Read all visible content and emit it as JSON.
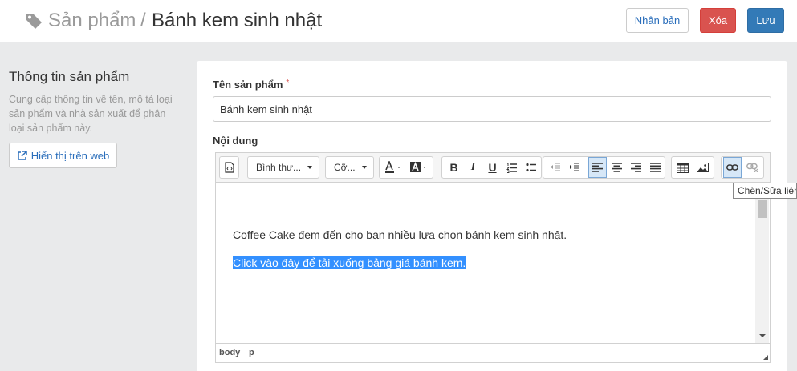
{
  "header": {
    "breadcrumb_root": "Sản phẩm",
    "breadcrumb_sep": "/",
    "title": "Bánh kem sinh nhật",
    "duplicate_label": "Nhân bản",
    "delete_label": "Xóa",
    "save_label": "Lưu"
  },
  "sidebar": {
    "title": "Thông tin sản phẩm",
    "description": "Cung cấp thông tin về tên, mô tả loại sản phẩm và nhà sản xuất để phân loại sản phẩm này.",
    "web_button_label": "Hiển thị trên web"
  },
  "form": {
    "name_label": "Tên sản phẩm",
    "required_mark": "*",
    "name_value": "Bánh kem sinh nhật",
    "content_label": "Nội dung"
  },
  "editor": {
    "format_select": "Bình thư...",
    "size_select": "Cỡ...",
    "paragraph_1": "Coffee Cake đem đến cho bạn nhiều lựa chọn bánh kem sinh nhật.",
    "paragraph_2": "Click vào đây để tải xuống bảng giá bánh kem.",
    "status_path_1": "body",
    "status_path_2": "p",
    "tooltip": "Chèn/Sửa liên kết"
  },
  "colors": {
    "primary": "#337ab7",
    "danger": "#d9534f",
    "selection": "#3390ff",
    "link": "#2a6ebb"
  }
}
